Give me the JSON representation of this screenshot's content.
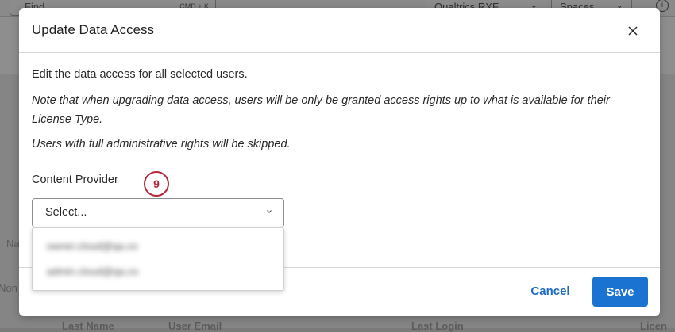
{
  "background": {
    "find_label": "Find",
    "find_shortcut": "CMD + K",
    "brand_dropdown": "Qualtrics RXF",
    "spaces_dropdown": "Spaces",
    "info_icon": "i",
    "table_partial_name": "Na",
    "row_partial_none": "Non",
    "col_last_name": "Last Name",
    "col_user_email": "User Email",
    "col_last_login": "Last Login",
    "col_license": "Licen"
  },
  "modal": {
    "title": "Update Data Access",
    "description": "Edit the data access for all selected users.",
    "note": "Note that when upgrading data access, users will be only be granted access rights up to what is available for their License Type.",
    "admin_note": "Users with full administrative rights will be skipped.",
    "field_label": "Content Provider",
    "step_badge": "9",
    "select_placeholder": "Select...",
    "dropdown_options": [
      "owner.cloud@qa.co",
      "admin.cloud@qa.co"
    ],
    "cancel_label": "Cancel",
    "save_label": "Save"
  },
  "colors": {
    "accent": "#1a73d1",
    "step_badge": "#b5283a"
  }
}
